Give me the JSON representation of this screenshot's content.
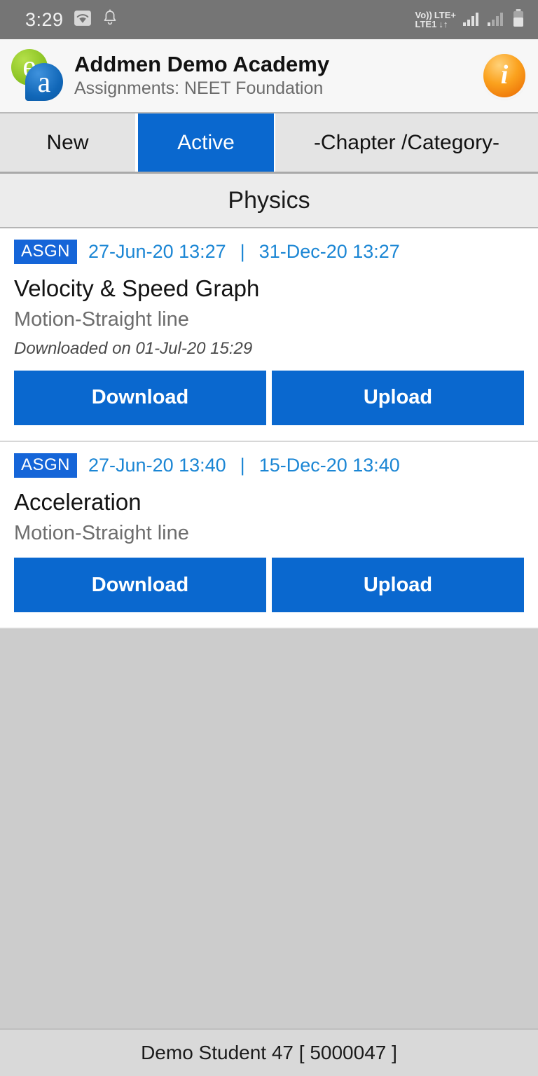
{
  "status_bar": {
    "time": "3:29",
    "wifi_icon": "wifi-icon",
    "notification_icon": "bell-icon",
    "volte_line1": "Vo))",
    "volte_line2": "LTE1",
    "network_label": "LTE+",
    "data_arrows": "↓↑",
    "signal_icon_1": "signal-bars-icon",
    "signal_icon_2": "signal-bars-icon",
    "battery_icon": "battery-icon",
    "background_color": "#757575"
  },
  "header": {
    "logo_letter_1": "e",
    "logo_letter_2": "a",
    "title": "Addmen Demo Academy",
    "subtitle": "Assignments: NEET Foundation",
    "info_glyph": "i",
    "info_icon_name": "info-icon"
  },
  "tabs": [
    {
      "label": "New",
      "selected": false
    },
    {
      "label": "Active",
      "selected": true
    },
    {
      "label": "-Chapter /Category-",
      "selected": false
    }
  ],
  "section": {
    "title": "Physics"
  },
  "assignments": [
    {
      "badge": "ASGN",
      "start_date": "27-Jun-20 13:27",
      "separator": "|",
      "end_date": "31-Dec-20 13:27",
      "title": "Velocity & Speed Graph",
      "subject": "Motion-Straight line",
      "note": "Downloaded on 01-Jul-20 15:29",
      "download_label": "Download",
      "upload_label": "Upload"
    },
    {
      "badge": "ASGN",
      "start_date": "27-Jun-20 13:40",
      "separator": "|",
      "end_date": "15-Dec-20 13:40",
      "title": "Acceleration",
      "subject": "Motion-Straight line",
      "note": "",
      "download_label": "Download",
      "upload_label": "Upload"
    }
  ],
  "footer": {
    "text": "Demo Student 47 [ 5000047 ]"
  },
  "colors": {
    "accent_blue": "#0a68cf",
    "badge_blue": "#1565d8",
    "date_blue": "#1b86d4",
    "page_gray": "#cccccc",
    "status_gray": "#757575",
    "footer_gray": "#d9d9d9"
  }
}
